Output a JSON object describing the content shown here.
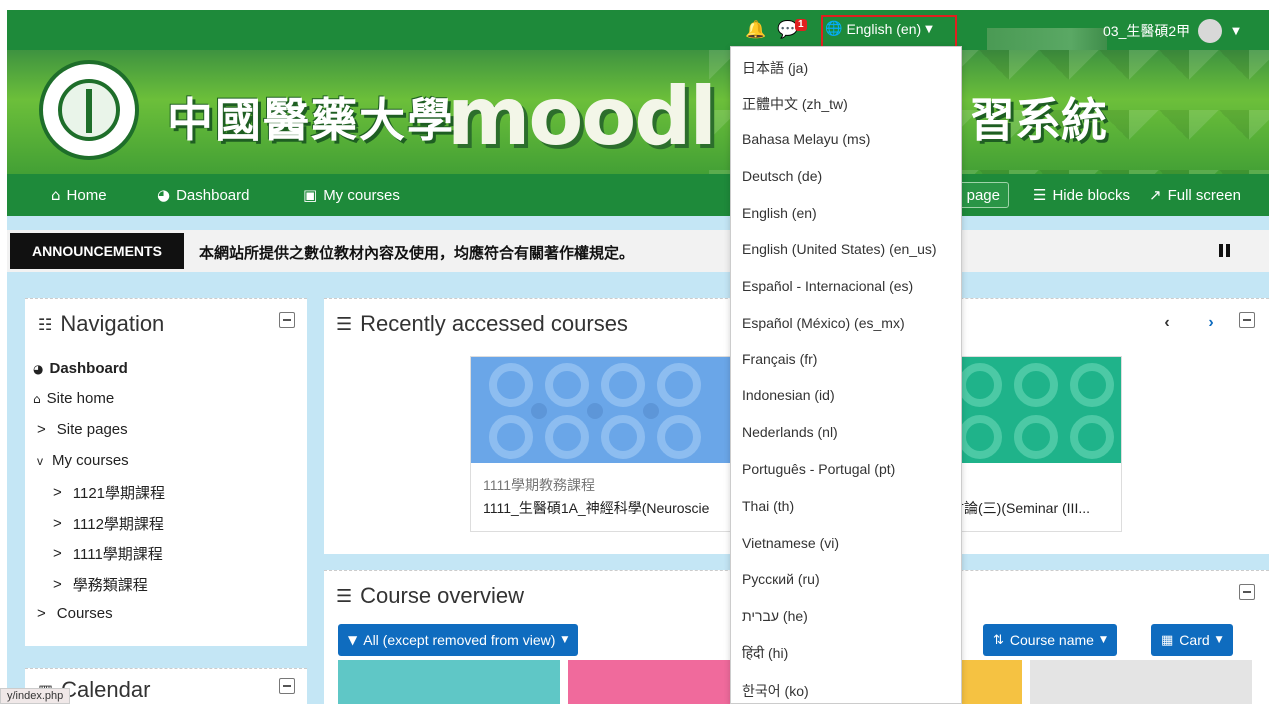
{
  "topbar": {
    "notif_count": "1",
    "language_label": "English (en)",
    "username": "03_生醫碩2甲"
  },
  "banner": {
    "title_left": "中國醫藥大學",
    "moodle_text": "moodl",
    "title_right": "習系統"
  },
  "navbar": {
    "home": "Home",
    "dashboard": "Dashboard",
    "my_courses": "My courses",
    "customise_page": "page",
    "hide_blocks": "Hide blocks",
    "full_screen": "Full screen"
  },
  "announcements": {
    "label": "ANNOUNCEMENTS",
    "text": "本網站所提供之數位教材內容及使用，均應符合有關著作權規定。"
  },
  "navigation_block": {
    "title": "Navigation",
    "items": [
      {
        "label": "Dashboard",
        "prefix": ""
      },
      {
        "label": "Site home",
        "prefix": ""
      },
      {
        "label": "Site pages",
        "prefix": ">"
      },
      {
        "label": "My courses",
        "prefix": "v"
      },
      {
        "label": "1121學期課程",
        "prefix": ">"
      },
      {
        "label": "1112學期課程",
        "prefix": ">"
      },
      {
        "label": "1111學期課程",
        "prefix": ">"
      },
      {
        "label": "學務類課程",
        "prefix": ">"
      },
      {
        "label": "Courses",
        "prefix": ">"
      }
    ]
  },
  "calendar_block": {
    "title": "Calendar"
  },
  "recent_courses": {
    "title": "Recently accessed courses",
    "cards": [
      {
        "category": "1111學期教務課程",
        "name": "1111_生醫碩1A_神經科學(Neuroscie"
      },
      {
        "category": "",
        "name": "討論(三)(Seminar (III..."
      }
    ]
  },
  "course_overview": {
    "title": "Course overview",
    "filter_label": "All (except removed from view)",
    "sort_label": "Course name",
    "view_label": "Card"
  },
  "language_menu": {
    "items": [
      "日本語 (ja)",
      "正體中文 (zh_tw)",
      "Bahasa Melayu (ms)",
      "Deutsch (de)",
      "English (en)",
      "English (United States) (en_us)",
      "Español - Internacional (es)",
      "Español (México) (es_mx)",
      "Français (fr)",
      "Indonesian (id)",
      "Nederlands (nl)",
      "Português - Portugal (pt)",
      "Thai (th)",
      "Vietnamese (vi)",
      "Русский (ru)",
      "עברית (he)",
      "हिंदी (hi)",
      "한국어 (ko)"
    ]
  },
  "status_bar": {
    "url": "y/index.php"
  },
  "colors": {
    "brand_green": "#1e8a3a",
    "primary_blue": "#0f6cbf",
    "highlight_red": "#e02020"
  }
}
